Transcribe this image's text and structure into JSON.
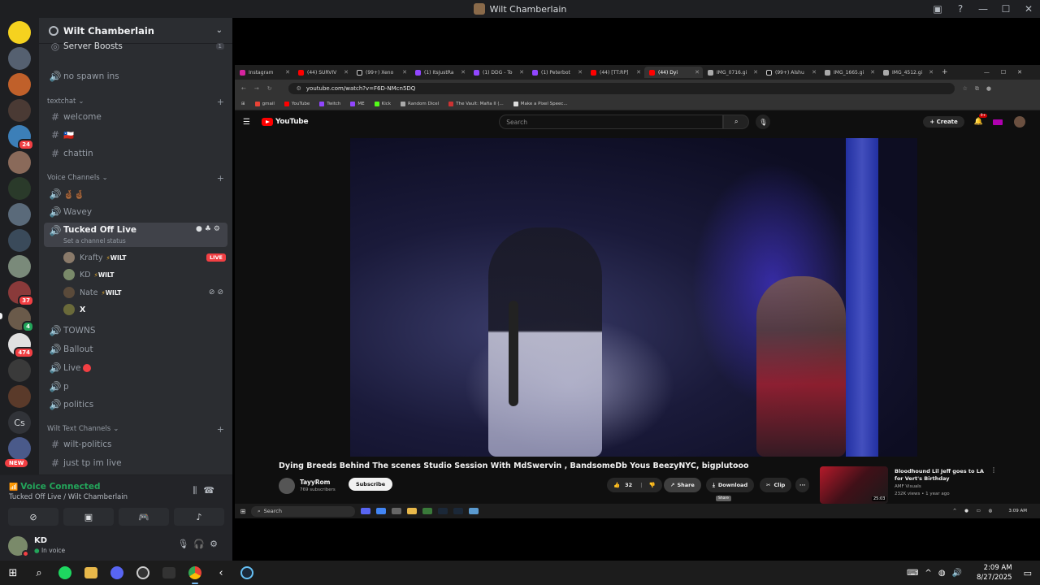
{
  "window": {
    "title": "Wilt Chamberlain"
  },
  "server": {
    "name": "Wilt Chamberlain",
    "boosts_label": "Server Boosts",
    "boosts_count": "1"
  },
  "rail": {
    "badges": [
      "24",
      "37",
      "474"
    ],
    "small_badge": "4",
    "text_server": "Cs",
    "new_label": "NEW"
  },
  "channels": {
    "no_spawn": "no spawn ins",
    "textchat_cat": "textchat",
    "welcome": "welcome",
    "flag": "🇨🇱",
    "chattin": "chattin",
    "voice_cat": "Voice Channels",
    "fingers": "🤞🏾🤞🏾",
    "wavey": "Wavey",
    "tucked": "Tucked Off Live",
    "tucked_status": "Set a channel status",
    "towns": "TOWNS",
    "ballout": "Ballout",
    "live": "Live",
    "p": "p",
    "politics": "politics",
    "wilt_text_cat": "Wilt Text Channels",
    "wilt_politics": "wilt-politics",
    "just_tp": "just tp im live"
  },
  "voice_users": [
    {
      "name": "Krafty",
      "tag": "WILT",
      "badge": "LIVE"
    },
    {
      "name": "KD",
      "tag": "WILT"
    },
    {
      "name": "Nate",
      "tag": "WILT"
    },
    {
      "name": "X"
    }
  ],
  "voice_panel": {
    "status": "Voice Connected",
    "location": "Tucked Off Live / Wilt Chamberlain"
  },
  "user_panel": {
    "name": "KD",
    "status": "In voice"
  },
  "browser": {
    "tabs": [
      "Instagram",
      "(44) SURVIV",
      "(99+) Xeno",
      "(1) ItsJustRa",
      "(1) DDG - To",
      "(1) Peterbot",
      "(44) [TT:RP]",
      "(44) Dyi",
      "IMG_0716.gi",
      "(99+) Alshu",
      "IMG_1665.gi",
      "IMG_4512.gi"
    ],
    "url": "youtube.com/watch?v=F6D-NMcn5DQ",
    "bookmarks": [
      "gmail",
      "YouTube",
      "Twitch",
      "ME",
      "Kick",
      "Random Dicel",
      "The Vault: Mafia II (...",
      "Make a Pixel Speec..."
    ]
  },
  "youtube": {
    "logo": "YouTube",
    "search_placeholder": "Search",
    "create_label": "Create",
    "notif_count": "9+",
    "video_title": "Dying Breeds Behind The scenes Studio Session With MdSwervin , BandsomeDb Yous BeezyNYC, bigplutooo",
    "channel_name": "TayyRom",
    "subscribers": "769 subscribers",
    "subscribe_label": "Subscribe",
    "likes": "32",
    "share_label": "Share",
    "share_tooltip": "Share",
    "download_label": "Download",
    "clip_label": "Clip",
    "more_label": "···",
    "rec_title": "Bloodhound Lil Jeff goes to LA for Vert's Birthday",
    "rec_channel": "AMF Visuals",
    "rec_views": "232K views • 1 year ago",
    "rec_duration": "25:03"
  },
  "inner_taskbar": {
    "search": "Search",
    "time": "3:09 AM"
  },
  "taskbar": {
    "time": "2:09 AM",
    "date": "8/27/2025"
  },
  "colors": {
    "discord_bg": "#2b2d31",
    "discord_dark": "#1e1f22",
    "voice_green": "#23a55a",
    "live_red": "#f23f43",
    "yt_red": "#ff0000"
  }
}
